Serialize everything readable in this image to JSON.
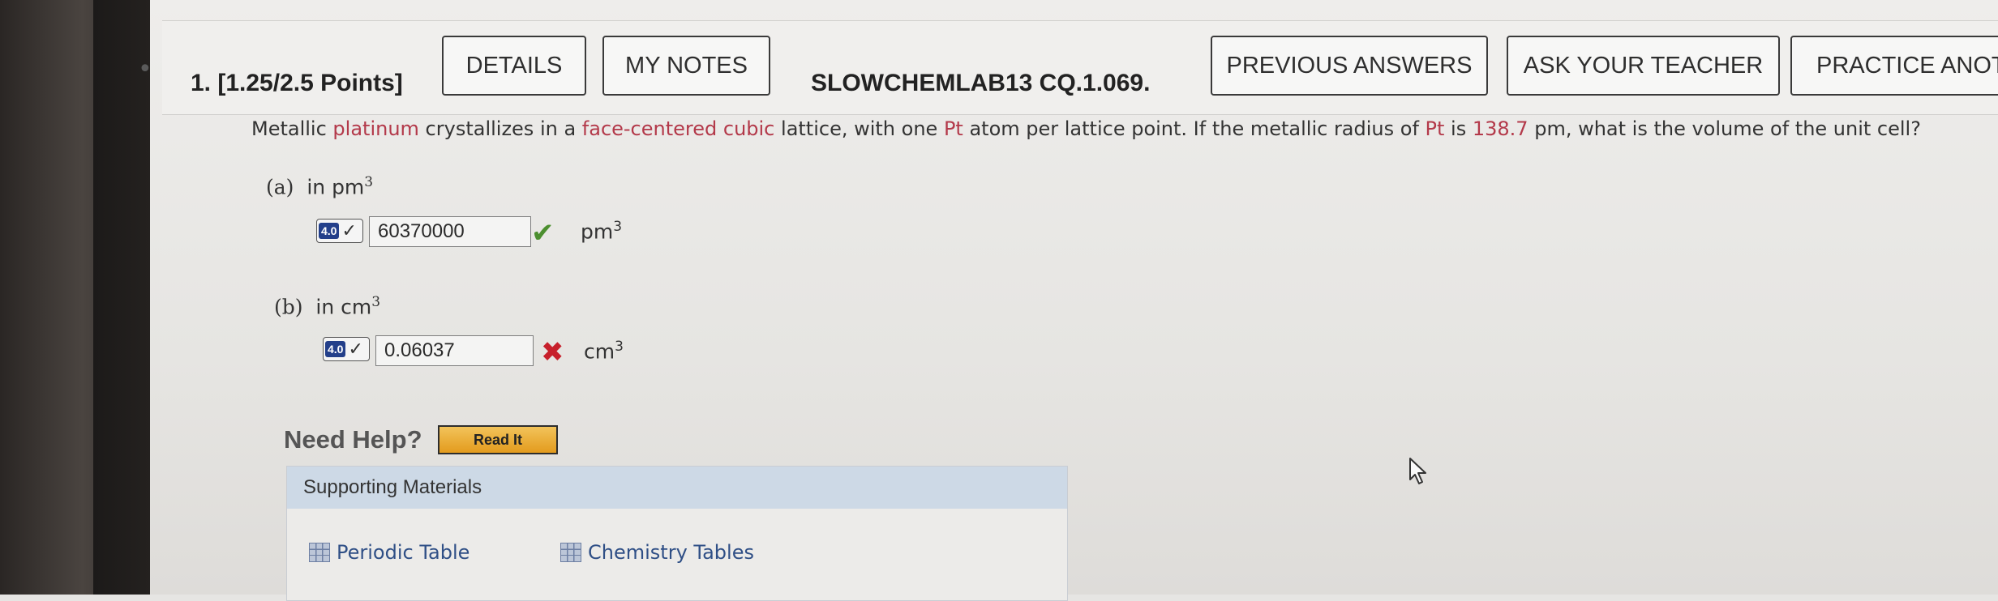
{
  "header": {
    "question_number": "1. [1.25/2.5 Points]",
    "details_label": "DETAILS",
    "my_notes_label": "MY NOTES",
    "problem_code": "SLOWCHEMLAB13 CQ.1.069.",
    "previous_answers_label": "PREVIOUS ANSWERS",
    "ask_teacher_label": "ASK YOUR TEACHER",
    "practice_label": "PRACTICE ANOTHE"
  },
  "question": {
    "t1": "Metallic ",
    "element": "platinum",
    "t2": " crystallizes in a ",
    "lattice": "face-centered cubic",
    "t3": " lattice, with one ",
    "symbol1": "Pt",
    "t4": " atom per lattice point. If the metallic radius of ",
    "symbol2": "Pt",
    "t5": " is ",
    "radius": "138.7",
    "t6": " pm, what is the volume of the unit cell?"
  },
  "parts": [
    {
      "letter": "(a)",
      "prompt": "in pm",
      "prompt_exp": "3",
      "badge": "4.0",
      "answer": "60370000",
      "status": "correct",
      "unit": "pm",
      "unit_exp": "3"
    },
    {
      "letter": "(b)",
      "prompt": "in cm",
      "prompt_exp": "3",
      "badge": "4.0",
      "answer": "0.06037",
      "status": "incorrect",
      "unit": "cm",
      "unit_exp": "3"
    }
  ],
  "help": {
    "need_help": "Need Help?",
    "read_it": "Read It"
  },
  "support": {
    "title": "Supporting Materials",
    "links": [
      "Periodic Table",
      "Chemistry Tables"
    ]
  },
  "icons": {
    "correct": "checkmark-icon",
    "incorrect": "x-icon",
    "table": "table-icon",
    "cursor": "mouse-pointer-icon"
  },
  "colors": {
    "highlight": "#b3394a",
    "correct": "#4c8f2f",
    "incorrect": "#c7202b",
    "badge": "#233f8a",
    "read_it": "#e39b1d"
  }
}
